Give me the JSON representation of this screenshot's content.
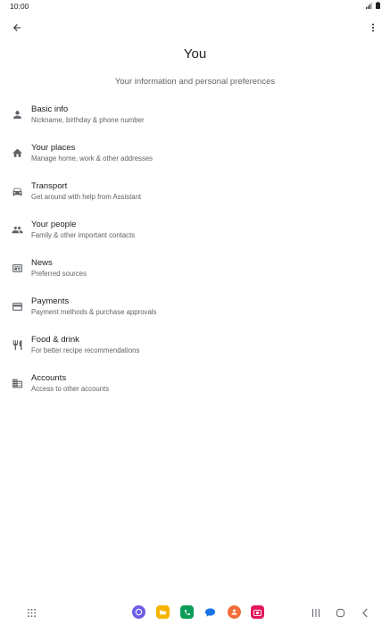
{
  "status": {
    "time": "10:00"
  },
  "header": {
    "title": "You",
    "subtitle": "Your information and personal preferences"
  },
  "items": [
    {
      "title": "Basic info",
      "subtitle": "Nickname, birthday & phone number",
      "icon": "person-icon"
    },
    {
      "title": "Your places",
      "subtitle": "Manage home, work & other addresses",
      "icon": "home-icon"
    },
    {
      "title": "Transport",
      "subtitle": "Get around with help from Assistant",
      "icon": "car-icon"
    },
    {
      "title": "Your people",
      "subtitle": "Family & other important contacts",
      "icon": "people-icon"
    },
    {
      "title": "News",
      "subtitle": "Preferred sources",
      "icon": "news-icon"
    },
    {
      "title": "Payments",
      "subtitle": "Payment methods & purchase approvals",
      "icon": "credit-card-icon"
    },
    {
      "title": "Food & drink",
      "subtitle": "For better recipe recommendations",
      "icon": "restaurant-icon"
    },
    {
      "title": "Accounts",
      "subtitle": "Access to other accounts",
      "icon": "building-icon"
    }
  ],
  "colors": {
    "text": "#202124",
    "secondary_text": "#5f6368",
    "icon": "#5f6368"
  }
}
